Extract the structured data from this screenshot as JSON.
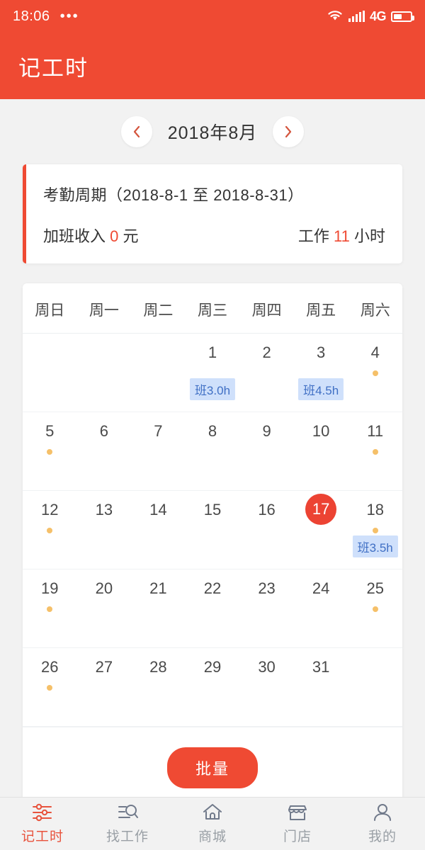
{
  "statusbar": {
    "time": "18:06",
    "overflow": "•••",
    "network_label": "4G",
    "icons": [
      "wifi-icon",
      "signal-bars-icon",
      "battery-icon"
    ]
  },
  "appbar": {
    "title": "记工时"
  },
  "month_nav": {
    "prev_label": "‹",
    "next_label": "›",
    "current_month": "2018年8月"
  },
  "summary": {
    "period": "考勤周期（2018-8-1 至 2018-8-31）",
    "overtime_prefix": "加班收入",
    "overtime_value": "0",
    "overtime_suffix": "元",
    "work_prefix": "工作",
    "work_value": "11",
    "work_suffix": "小时"
  },
  "calendar": {
    "weekdays": [
      "周日",
      "周一",
      "周二",
      "周三",
      "周四",
      "周五",
      "周六"
    ],
    "leading_blanks": 3,
    "days": [
      {
        "n": "1",
        "dot": false,
        "shift": "班3.0h",
        "selected": false
      },
      {
        "n": "2",
        "dot": false,
        "shift": null,
        "selected": false
      },
      {
        "n": "3",
        "dot": false,
        "shift": "班4.5h",
        "selected": false
      },
      {
        "n": "4",
        "dot": true,
        "shift": null,
        "selected": false
      },
      {
        "n": "5",
        "dot": true,
        "shift": null,
        "selected": false
      },
      {
        "n": "6",
        "dot": false,
        "shift": null,
        "selected": false
      },
      {
        "n": "7",
        "dot": false,
        "shift": null,
        "selected": false
      },
      {
        "n": "8",
        "dot": false,
        "shift": null,
        "selected": false
      },
      {
        "n": "9",
        "dot": false,
        "shift": null,
        "selected": false
      },
      {
        "n": "10",
        "dot": false,
        "shift": null,
        "selected": false
      },
      {
        "n": "11",
        "dot": true,
        "shift": null,
        "selected": false
      },
      {
        "n": "12",
        "dot": true,
        "shift": null,
        "selected": false
      },
      {
        "n": "13",
        "dot": false,
        "shift": null,
        "selected": false
      },
      {
        "n": "14",
        "dot": false,
        "shift": null,
        "selected": false
      },
      {
        "n": "15",
        "dot": false,
        "shift": null,
        "selected": false
      },
      {
        "n": "16",
        "dot": false,
        "shift": null,
        "selected": false
      },
      {
        "n": "17",
        "dot": false,
        "shift": null,
        "selected": true
      },
      {
        "n": "18",
        "dot": true,
        "shift": "班3.5h",
        "selected": false
      },
      {
        "n": "19",
        "dot": true,
        "shift": null,
        "selected": false
      },
      {
        "n": "20",
        "dot": false,
        "shift": null,
        "selected": false
      },
      {
        "n": "21",
        "dot": false,
        "shift": null,
        "selected": false
      },
      {
        "n": "22",
        "dot": false,
        "shift": null,
        "selected": false
      },
      {
        "n": "23",
        "dot": false,
        "shift": null,
        "selected": false
      },
      {
        "n": "24",
        "dot": false,
        "shift": null,
        "selected": false
      },
      {
        "n": "25",
        "dot": true,
        "shift": null,
        "selected": false
      },
      {
        "n": "26",
        "dot": true,
        "shift": null,
        "selected": false
      },
      {
        "n": "27",
        "dot": false,
        "shift": null,
        "selected": false
      },
      {
        "n": "28",
        "dot": false,
        "shift": null,
        "selected": false
      },
      {
        "n": "29",
        "dot": false,
        "shift": null,
        "selected": false
      },
      {
        "n": "30",
        "dot": false,
        "shift": null,
        "selected": false
      },
      {
        "n": "31",
        "dot": false,
        "shift": null,
        "selected": false
      }
    ],
    "batch_button": "批量"
  },
  "tabbar": {
    "items": [
      {
        "label": "记工时",
        "icon": "sliders-icon",
        "active": true
      },
      {
        "label": "找工作",
        "icon": "search-list-icon",
        "active": false
      },
      {
        "label": "商城",
        "icon": "home-icon",
        "active": false
      },
      {
        "label": "门店",
        "icon": "store-icon",
        "active": false
      },
      {
        "label": "我的",
        "icon": "person-icon",
        "active": false
      }
    ]
  },
  "colors": {
    "brand": "#ef4a33",
    "selected_day": "#ec4333",
    "dot": "#f5c069",
    "shift_bg": "#cfe0fb",
    "shift_text": "#3f6fc4",
    "page_bg": "#f2f2f2",
    "inactive_tab": "#9aa0a6"
  }
}
